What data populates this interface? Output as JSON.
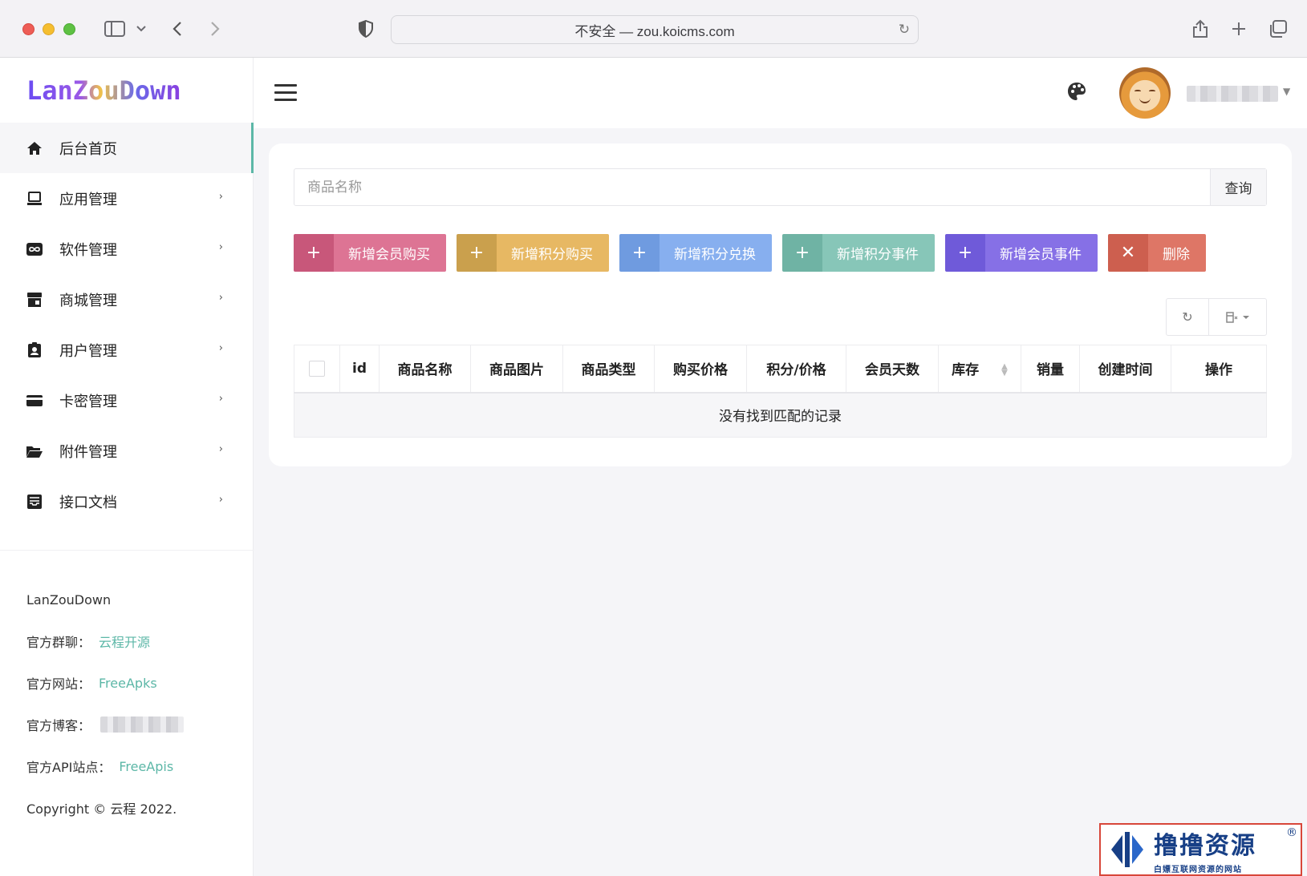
{
  "browser": {
    "url_text": "不安全 — zou.koicms.com"
  },
  "sidebar": {
    "logo_text": "LanZouDown",
    "items": [
      {
        "label": "后台首页",
        "icon": "home-icon",
        "has_submenu": false,
        "active": true
      },
      {
        "label": "应用管理",
        "icon": "desktop-icon",
        "has_submenu": true
      },
      {
        "label": "软件管理",
        "icon": "infinity-icon",
        "has_submenu": true
      },
      {
        "label": "商城管理",
        "icon": "store-icon",
        "has_submenu": true
      },
      {
        "label": "用户管理",
        "icon": "user-badge-icon",
        "has_submenu": true
      },
      {
        "label": "卡密管理",
        "icon": "card-icon",
        "has_submenu": true
      },
      {
        "label": "附件管理",
        "icon": "folder-open-icon",
        "has_submenu": true
      },
      {
        "label": "接口文档",
        "icon": "inbox-icon",
        "has_submenu": true
      }
    ],
    "arrow": "›",
    "footer": {
      "brand": "LanZouDown",
      "group_label": "官方群聊：",
      "group_link": "云程开源",
      "site_label": "官方网站：",
      "site_link": "FreeApks",
      "blog_label": "官方博客：",
      "api_label": "官方API站点：",
      "api_link": "FreeApis",
      "copyright": "Copyright © 云程 2022."
    }
  },
  "header": {
    "menu_icon": "hamburger-icon",
    "theme_icon": "palette-icon"
  },
  "search": {
    "placeholder": "商品名称",
    "button_label": "查询"
  },
  "actions": [
    {
      "icon": "+",
      "label": "新增会员购买",
      "color_icon": "#c8577a",
      "color_label": "#dd7494"
    },
    {
      "icon": "+",
      "label": "新增积分购买",
      "color_icon": "#caa04d",
      "color_label": "#e7b863"
    },
    {
      "icon": "+",
      "label": "新增积分兑换",
      "color_icon": "#6f9be0",
      "color_label": "#87afef"
    },
    {
      "icon": "+",
      "label": "新增积分事件",
      "color_icon": "#6fb3a4",
      "color_label": "#87c6b8"
    },
    {
      "icon": "+",
      "label": "新增会员事件",
      "color_icon": "#6f5ad9",
      "color_label": "#8670e6"
    },
    {
      "icon": "✕",
      "label": "删除",
      "color_icon": "#cd5f4f",
      "color_label": "#de7666"
    }
  ],
  "table": {
    "columns": [
      "id",
      "商品名称",
      "商品图片",
      "商品类型",
      "购买价格",
      "积分/价格",
      "会员天数",
      "库存",
      "销量",
      "创建时间",
      "操作"
    ],
    "empty_text": "没有找到匹配的记录"
  },
  "watermark": {
    "title": "撸撸资源",
    "subtitle": "白嫖互联网资源的网站",
    "reg": "®"
  },
  "colors": {
    "accent": "#5cb7a7",
    "page_bg": "#f5f5f8"
  }
}
